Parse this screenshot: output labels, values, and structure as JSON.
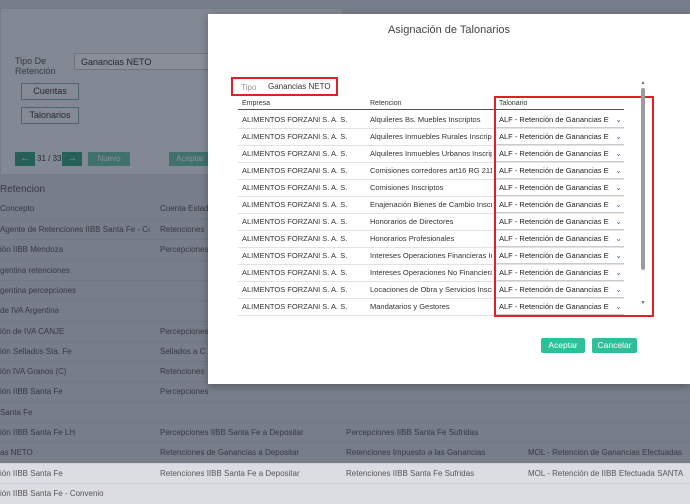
{
  "background": {
    "form": {
      "tipo_retencion_label": "Tipo De Retención",
      "tipo_retencion_value": "Ganancias NETO",
      "cuentas_button": "Cuentas",
      "talonarios_button": "Talonarios",
      "nav_counter": "31 / 33",
      "nuevo_button": "Nuevo",
      "aceptar_button": "Aceptar"
    },
    "section_title": "Retencion",
    "headers": [
      "Concepto",
      "Cuenta Estado"
    ],
    "rows": [
      {
        "c1": "Agente de Retenciones IIBB Santa Fe - Co...",
        "c2": "Retenciones",
        "c3": "",
        "c4": ""
      },
      {
        "c1": "ión IIBB Mendoza",
        "c2": "Percepciones",
        "c3": "",
        "c4": ""
      },
      {
        "c1": "gentina retenciones",
        "c2": "",
        "c3": "",
        "c4": ""
      },
      {
        "c1": "gentina percepciones",
        "c2": "",
        "c3": "",
        "c4": ""
      },
      {
        "c1": "de IVA Argentina",
        "c2": "",
        "c3": "",
        "c4": ""
      },
      {
        "c1": "ión de IVA CANJE",
        "c2": "Percepciones",
        "c3": "",
        "c4": ""
      },
      {
        "c1": "ión Sellados Sta. Fe",
        "c2": "Sellados a C",
        "c3": "",
        "c4": ""
      },
      {
        "c1": "ión IVA Granos (C)",
        "c2": "Retenciones",
        "c3": "",
        "c4": ""
      },
      {
        "c1": "ión IIBB Santa Fe",
        "c2": "Percepciones",
        "c3": "",
        "c4": ""
      },
      {
        "c1": "Santa Fe",
        "c2": "",
        "c3": "",
        "c4": ""
      },
      {
        "c1": "ión IIBB Santa Fe LH",
        "c2": "Percepciones IIBB Santa Fe a Depositar",
        "c3": "Percepciones IIBB Santa Fe Sufridas",
        "c4": ""
      },
      {
        "c1": "as NETO",
        "c2": "Retenciones de Ganancias a Depositar",
        "c3": "Retenciones Impuesto a las Ganancias",
        "c4": "MOL - Retención de Ganancias Efectuadas"
      },
      {
        "c1": "ión IIBB Santa Fe",
        "c2": "Retenciones IIBB Santa Fe a Depositar",
        "c3": "Retenciones IIBB Santa Fe Sufridas",
        "c4": "MOL - Retención de IIBB Efectuada SANTA"
      },
      {
        "c1": "ión IIBB Santa Fe - Convenio",
        "c2": "",
        "c3": "",
        "c4": ""
      }
    ]
  },
  "modal": {
    "title": "Asignación de Talonarios",
    "tipo_label": "Tipo",
    "tipo_value": "Ganancias NETO",
    "columns": {
      "empresa": "Empresa",
      "retencion": "Retencion",
      "talonario": "Talonario"
    },
    "rows": [
      {
        "empresa": "ALIMENTOS FORZANI S. A. S.",
        "retencion": "Alquileres Bs. Muebles Inscriptos",
        "talonario": "ALF - Retención de Ganancias Efec"
      },
      {
        "empresa": "ALIMENTOS FORZANI S. A. S.",
        "retencion": "Alquileres Inmuebles Rurales Inscript",
        "talonario": "ALF - Retención de Ganancias Efec"
      },
      {
        "empresa": "ALIMENTOS FORZANI S. A. S.",
        "retencion": "Alquileres Inmuebles Urbanos Inscrip",
        "talonario": "ALF - Retención de Ganancias Efec"
      },
      {
        "empresa": "ALIMENTOS FORZANI S. A. S.",
        "retencion": "Comisiones corredores art16 RG 2118",
        "talonario": "ALF - Retención de Ganancias Efec"
      },
      {
        "empresa": "ALIMENTOS FORZANI S. A. S.",
        "retencion": "Comisiones Inscriptos",
        "talonario": "ALF - Retención de Ganancias Efec"
      },
      {
        "empresa": "ALIMENTOS FORZANI S. A. S.",
        "retencion": "Enajenación Bienes de Cambio Inscri",
        "talonario": "ALF - Retención de Ganancias Efec"
      },
      {
        "empresa": "ALIMENTOS FORZANI S. A. S.",
        "retencion": "Honorarios de Directores",
        "talonario": "ALF - Retención de Ganancias Efec"
      },
      {
        "empresa": "ALIMENTOS FORZANI S. A. S.",
        "retencion": "Honorarios Profesionales",
        "talonario": "ALF - Retención de Ganancias Efec"
      },
      {
        "empresa": "ALIMENTOS FORZANI S. A. S.",
        "retencion": "Intereses Operaciones Financieras In",
        "talonario": "ALF - Retención de Ganancias Efec"
      },
      {
        "empresa": "ALIMENTOS FORZANI S. A. S.",
        "retencion": "Intereses Operaciones No Financieras",
        "talonario": "ALF - Retención de Ganancias Efec"
      },
      {
        "empresa": "ALIMENTOS FORZANI S. A. S.",
        "retencion": "Locaciones de Obra y Servicios Inscri",
        "talonario": "ALF - Retención de Ganancias Efec"
      },
      {
        "empresa": "ALIMENTOS FORZANI S. A. S.",
        "retencion": "Mandatarios y Gestores",
        "talonario": "ALF - Retención de Ganancias Efec"
      }
    ],
    "aceptar_button": "Aceptar",
    "cancelar_button": "Cancelar"
  },
  "colors": {
    "accent": "#2ec09a",
    "highlight": "#e01f26",
    "nav_green": "#38a17f"
  },
  "icons": {
    "select_chevron": "chevron-down-icon",
    "prev": "arrow-left-icon",
    "next": "arrow-right-icon"
  }
}
